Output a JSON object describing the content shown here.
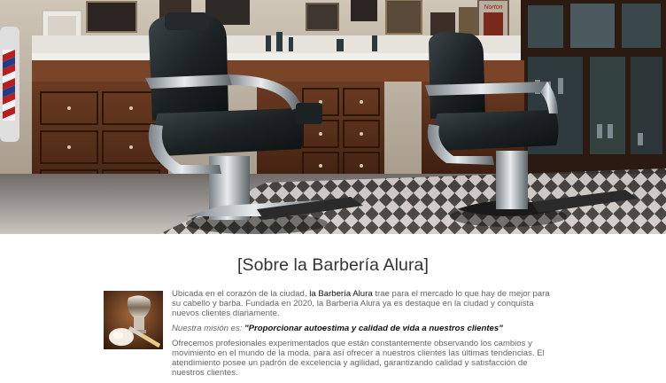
{
  "hero": {
    "image_alt": "Barber shop interior with two vintage barber chairs",
    "sign_text": "Norton"
  },
  "about": {
    "title": "[Sobre la Barbería Alura]",
    "photo_alt": "Shaving brush and razor",
    "p1_before": "Ubicada en el corazón de la ciudad, ",
    "p1_brand": "la Barbería Alura",
    "p1_after": " trae para el mercado lo que hay de mejor para su cabello y barba. Fundada en 2020, la Barbería Alura ya es destaque en la ciudad y conquista nuevos clientes diariamente.",
    "mission_label": "Nuestra misión es: ",
    "mission_quote": "\"Proporcionar autoestima y calidad de vida a nuestros clientes\"",
    "p3": "Ofrecemos profesionales experimentados que están constantemente observando los cambios y movimiento en el mundo de la moda, para así ofrecer a nuestros clientes las últimas tendencias. El atendimiento posee un padrón de excelencia y agilidad, garantizando calidad y satisfacción de nuestros clientes."
  }
}
